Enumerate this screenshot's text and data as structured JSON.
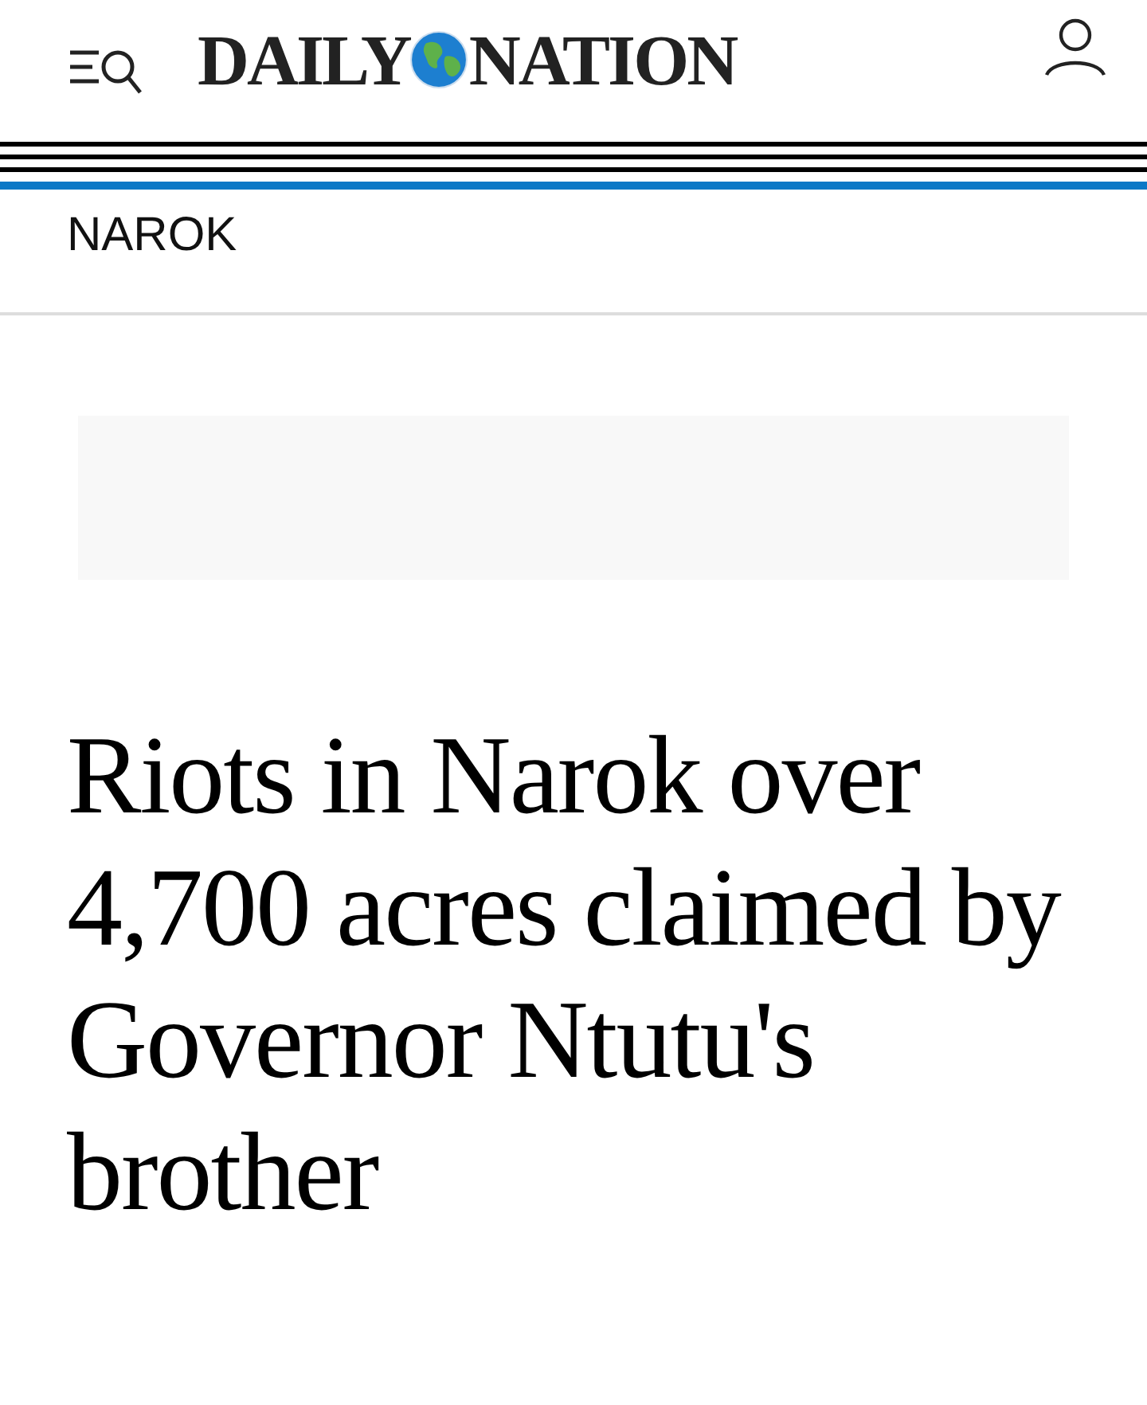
{
  "header": {
    "logo": {
      "left": "DAILY",
      "right": "NATION"
    }
  },
  "section": {
    "label": "NAROK"
  },
  "article": {
    "headline": "Riots in Narok over 4,700 acres claimed by Governor Ntutu's brother"
  }
}
